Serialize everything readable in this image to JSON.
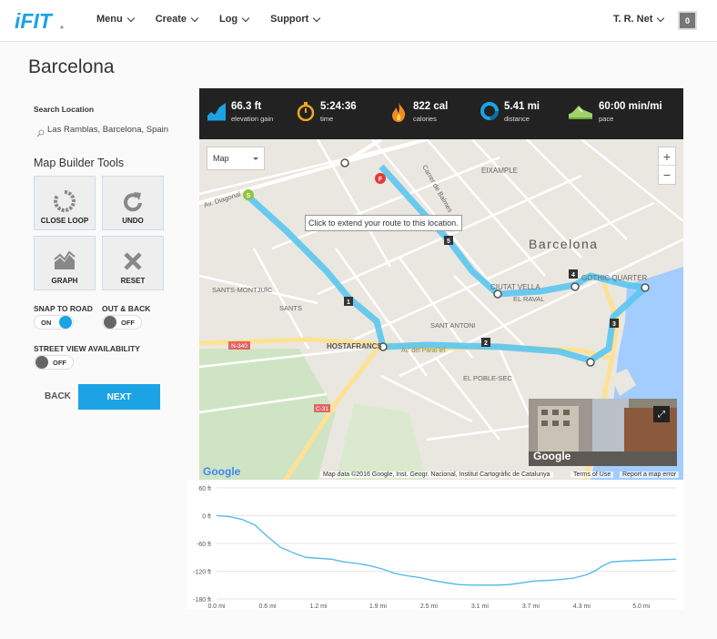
{
  "header": {
    "logo_text": "iFIT",
    "nav": [
      {
        "label": "Menu"
      },
      {
        "label": "Create"
      },
      {
        "label": "Log"
      },
      {
        "label": "Support"
      }
    ],
    "user_name": "T. R. Net",
    "notification_count": "0"
  },
  "page": {
    "title": "Barcelona"
  },
  "search": {
    "label": "Search Location",
    "value": "Las Ramblas, Barcelona, Spain"
  },
  "tools": {
    "title": "Map Builder Tools",
    "buttons": [
      {
        "label": "CLOSE LOOP",
        "icon": "close-loop-icon"
      },
      {
        "label": "UNDO",
        "icon": "undo-icon"
      },
      {
        "label": "GRAPH",
        "icon": "graph-icon"
      },
      {
        "label": "RESET",
        "icon": "reset-x-icon"
      }
    ]
  },
  "options": {
    "snap_to_road": {
      "label": "SNAP TO ROAD",
      "state": "ON"
    },
    "out_and_back": {
      "label": "OUT & BACK",
      "state": "OFF"
    },
    "street_view": {
      "label": "STREET VIEW AVAILABILITY",
      "state": "OFF"
    }
  },
  "actions": {
    "back": "BACK",
    "next": "NEXT"
  },
  "stats": [
    {
      "value": "66.3 ft",
      "label": "elevation gain",
      "icon": "elevation-icon"
    },
    {
      "value": "5:24:36",
      "label": "time",
      "icon": "stopwatch-icon"
    },
    {
      "value": "822 cal",
      "label": "calories",
      "icon": "flame-icon"
    },
    {
      "value": "5.41 mi",
      "label": "distance",
      "icon": "distance-ring-icon"
    },
    {
      "value": "60:00 min/mi",
      "label": "pace",
      "icon": "shoe-icon"
    }
  ],
  "map": {
    "type_select": "Map",
    "zoom_in": "+",
    "zoom_out": "−",
    "tooltip": "Click to extend your route to this location.",
    "labels": [
      "Av. Diagonal",
      "Carrer de Balmes",
      "EIXAMPLE",
      "Barcelona",
      "SANTS-MONTJUÏC",
      "SANTS",
      "HOSTAFRANCS",
      "SANT ANTONI",
      "CIUTAT VELLA",
      "EL RAVAL",
      "GOTHIC QUARTER",
      "EL POBLE-SEC",
      "Av. del Paral·lel",
      "N-340",
      "C-31"
    ],
    "markers": [
      "S",
      "F",
      "1",
      "2",
      "3",
      "4",
      "5"
    ],
    "google": "Google",
    "attribution": "Map data ©2016 Google, Inst. Geogr. Nacional, Institut Cartogràfic de Catalunya",
    "terms": "Terms of Use",
    "report": "Report a map error",
    "streetview_logo": "Google"
  },
  "chart_data": {
    "type": "area",
    "xlabel": "",
    "ylabel": "",
    "x_ticks": [
      "0.0 mi",
      "0.6 mi",
      "1.2 mi",
      "1.9 mi",
      "2.5 mi",
      "3.1 mi",
      "3.7 mi",
      "4.3 mi",
      "5.0 mi"
    ],
    "y_ticks": [
      "60 ft",
      "0 ft",
      "-60 ft",
      "-120 ft",
      "-180 ft"
    ],
    "ylim": [
      -180,
      60
    ],
    "xlim": [
      0,
      5.41
    ],
    "grid": true,
    "series": [
      {
        "x": [
          0.0,
          0.15,
          0.3,
          0.45,
          0.6,
          0.75,
          0.9,
          1.05,
          1.2,
          1.35,
          1.5,
          1.65,
          1.8,
          1.95,
          2.1,
          2.25,
          2.4,
          2.55,
          2.7,
          2.85,
          3.0,
          3.15,
          3.3,
          3.45,
          3.6,
          3.75,
          3.9,
          4.05,
          4.2,
          4.35,
          4.45,
          4.55,
          4.65,
          4.8,
          4.95,
          5.1,
          5.25,
          5.41
        ],
        "values": [
          0,
          -2,
          -8,
          -20,
          -45,
          -68,
          -80,
          -90,
          -92,
          -94,
          -100,
          -103,
          -108,
          -115,
          -125,
          -130,
          -134,
          -140,
          -145,
          -149,
          -150,
          -150,
          -150,
          -149,
          -145,
          -141,
          -140,
          -138,
          -135,
          -128,
          -120,
          -108,
          -100,
          -98,
          -97,
          -96,
          -95,
          -94
        ]
      }
    ],
    "color": "#4db8e8"
  }
}
